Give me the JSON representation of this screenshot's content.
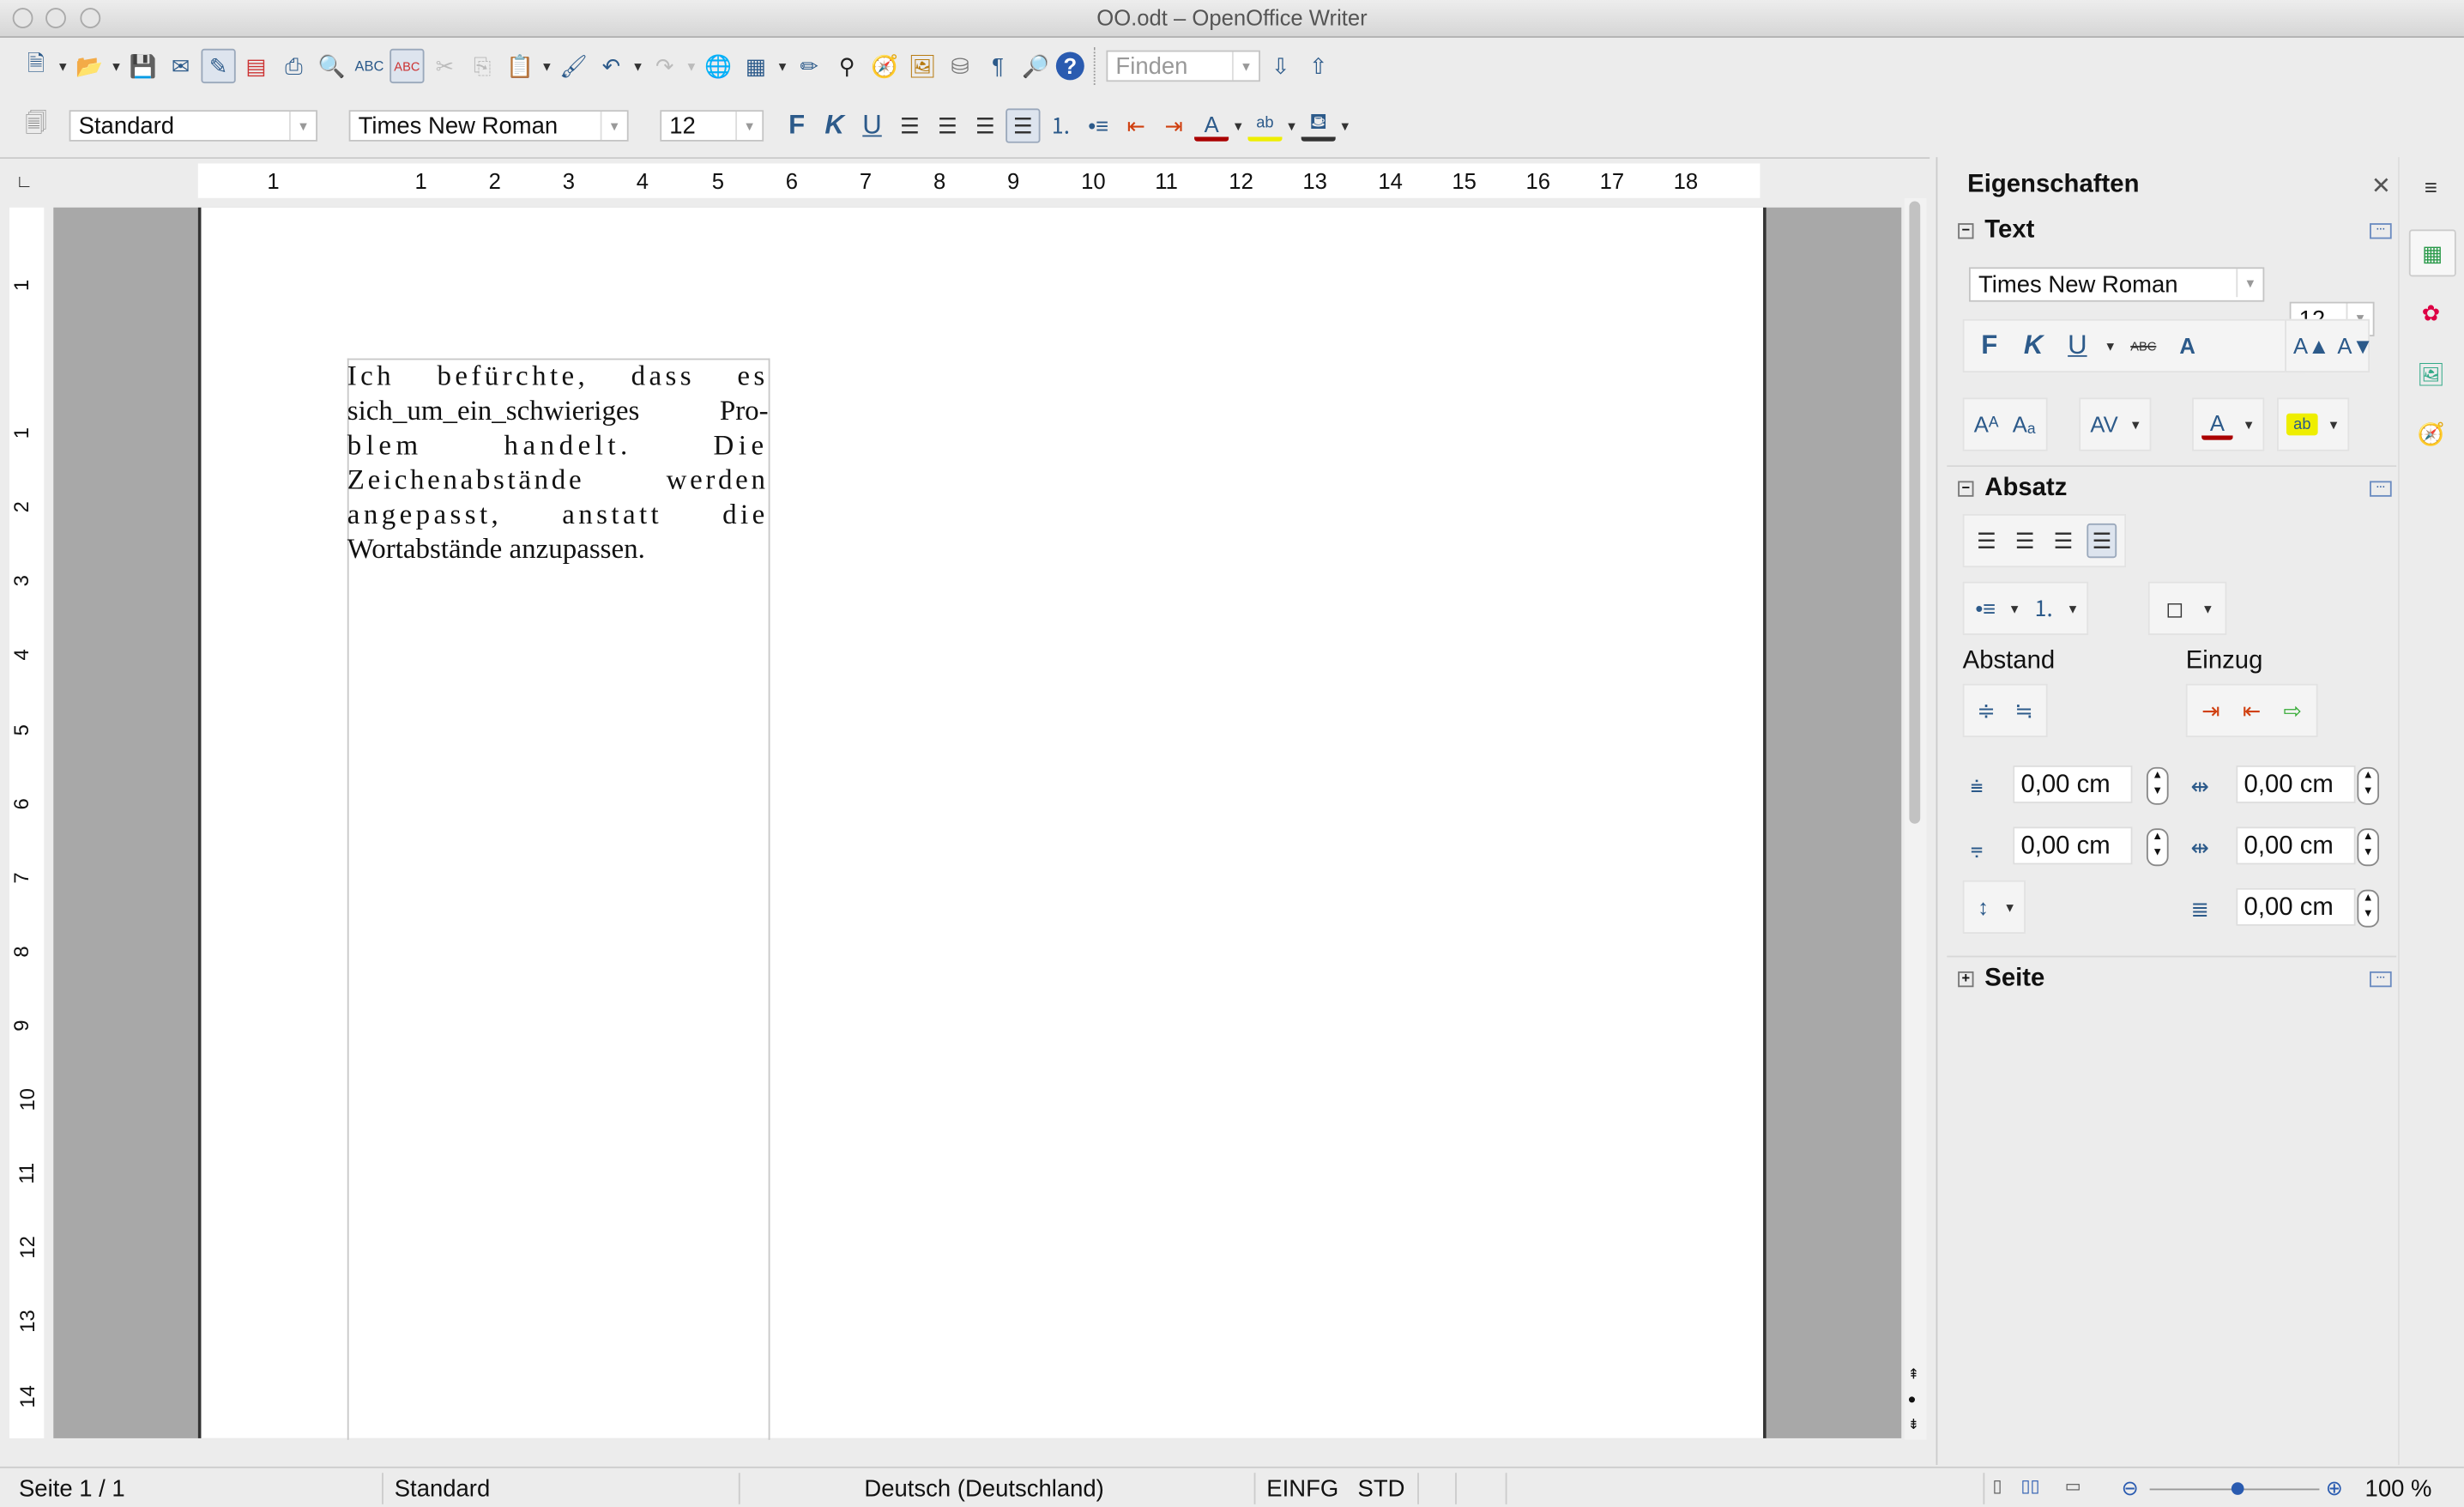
{
  "window": {
    "title": "OO.odt – OpenOffice Writer"
  },
  "toolbar": {
    "find_placeholder": "Finden"
  },
  "format_bar": {
    "style": "Standard",
    "font": "Times New Roman",
    "size": "12",
    "bold": "F",
    "italic": "K",
    "underline": "U"
  },
  "ruler": {
    "h_ticks": [
      "1",
      "1",
      "2",
      "3",
      "4",
      "5",
      "6",
      "7",
      "8",
      "9",
      "10",
      "11",
      "12",
      "13",
      "14",
      "15",
      "16",
      "17",
      "18"
    ],
    "v_ticks": [
      "1",
      "1",
      "2",
      "3",
      "4",
      "5",
      "6",
      "7",
      "8",
      "9",
      "10",
      "11",
      "12",
      "13",
      "14"
    ]
  },
  "document": {
    "lines": [
      "Ich befürchte, dass es",
      "sich_um_ein_schwieriges Pro-",
      "blem handelt. Die",
      "Zeichenabstände werden",
      "angepasst, anstatt die",
      "Wortabstände anzupassen."
    ]
  },
  "sidebar": {
    "title": "Eigenschaften",
    "text_section": "Text",
    "font": "Times New Roman",
    "size": "12",
    "bold": "F",
    "italic": "K",
    "underline": "U",
    "strike": "ABC",
    "paragraph_section": "Absatz",
    "spacing_label": "Abstand",
    "indent_label": "Einzug",
    "fields": {
      "above": "0,00 cm",
      "below": "0,00 cm",
      "before_text": "0,00 cm",
      "after_text": "0,00 cm",
      "first_line": "0,00 cm"
    },
    "page_section": "Seite"
  },
  "status": {
    "page": "Seite 1 / 1",
    "style": "Standard",
    "language": "Deutsch (Deutschland)",
    "insert_mode": "EINFG",
    "selection_mode": "STD",
    "zoom": "100 %"
  },
  "zoom_level_percent": 100
}
